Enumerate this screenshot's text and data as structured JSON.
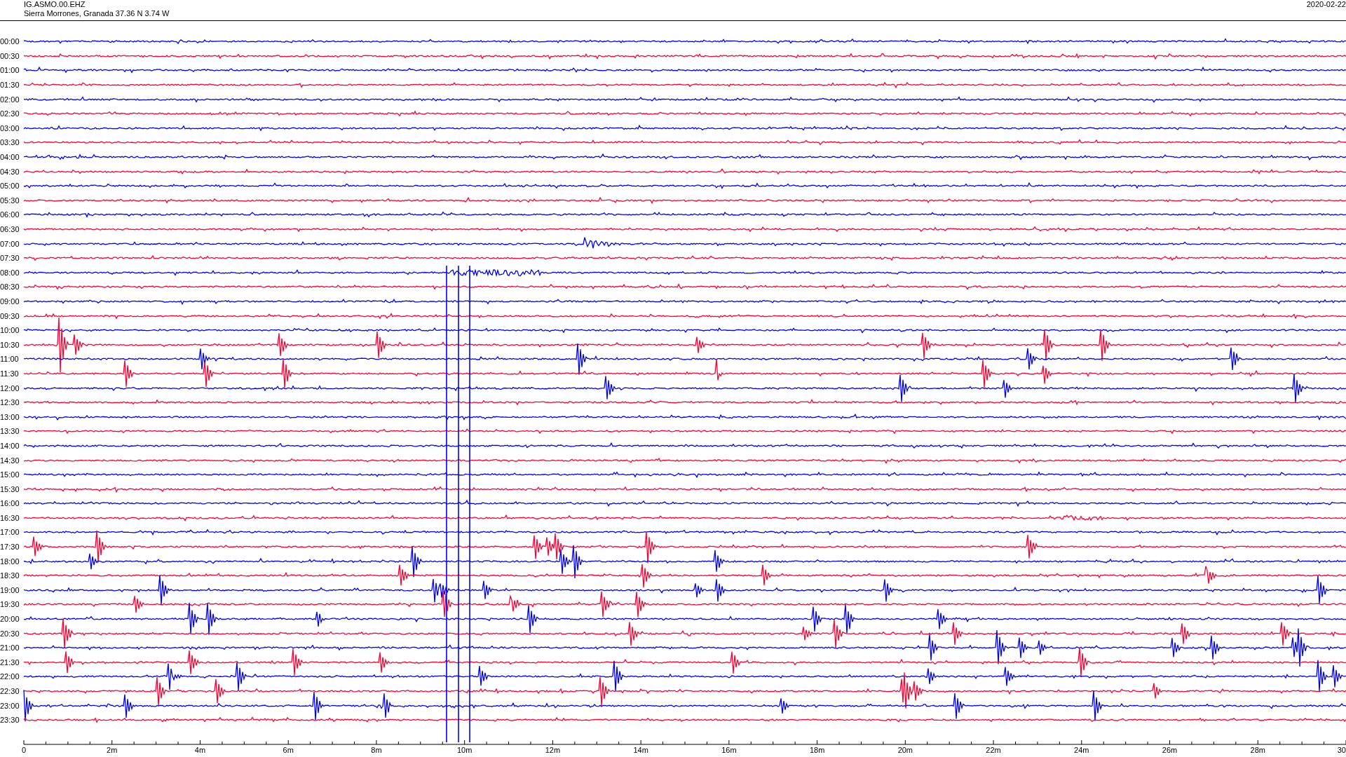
{
  "header": {
    "station": "IG.ASMO.00.EHZ",
    "location": "Sierra Morrones, Granada  37.36 N 3.74 W",
    "date": "2020-02-22"
  },
  "rows": [
    {
      "label": "00:00",
      "color": "#0000ff"
    },
    {
      "label": "00:30",
      "color": "#ff0033"
    },
    {
      "label": "01:00",
      "color": "#0000ff"
    },
    {
      "label": "01:30",
      "color": "#ff0033"
    },
    {
      "label": "02:00",
      "color": "#0000ff"
    },
    {
      "label": "02:30",
      "color": "#ff0033"
    },
    {
      "label": "03:00",
      "color": "#0000ff"
    },
    {
      "label": "03:30",
      "color": "#ff0033"
    },
    {
      "label": "04:00",
      "color": "#0000ff"
    },
    {
      "label": "04:30",
      "color": "#ff0033"
    },
    {
      "label": "05:00",
      "color": "#0000ff"
    },
    {
      "label": "05:30",
      "color": "#ff0033"
    },
    {
      "label": "06:00",
      "color": "#0000ff"
    },
    {
      "label": "06:30",
      "color": "#ff0033"
    },
    {
      "label": "07:00",
      "color": "#0000ff"
    },
    {
      "label": "07:30",
      "color": "#ff0033"
    },
    {
      "label": "08:00",
      "color": "#0000ff"
    },
    {
      "label": "08:30",
      "color": "#ff0033"
    },
    {
      "label": "09:00",
      "color": "#0000ff"
    },
    {
      "label": "09:30",
      "color": "#ff0033"
    },
    {
      "label": "10:00",
      "color": "#0000ff"
    },
    {
      "label": "10:30",
      "color": "#ff0033"
    },
    {
      "label": "11:00",
      "color": "#0000ff"
    },
    {
      "label": "11:30",
      "color": "#ff0033"
    },
    {
      "label": "12:00",
      "color": "#0000ff"
    },
    {
      "label": "12:30",
      "color": "#ff0033"
    },
    {
      "label": "13:00",
      "color": "#0000ff"
    },
    {
      "label": "13:30",
      "color": "#ff0033"
    },
    {
      "label": "14:00",
      "color": "#0000ff"
    },
    {
      "label": "14:30",
      "color": "#ff0033"
    },
    {
      "label": "15:00",
      "color": "#0000ff"
    },
    {
      "label": "15:30",
      "color": "#ff0033"
    },
    {
      "label": "16:00",
      "color": "#0000ff"
    },
    {
      "label": "16:30",
      "color": "#ff0033"
    },
    {
      "label": "17:00",
      "color": "#0000ff"
    },
    {
      "label": "17:30",
      "color": "#ff0033"
    },
    {
      "label": "18:00",
      "color": "#0000ff"
    },
    {
      "label": "18:30",
      "color": "#ff0033"
    },
    {
      "label": "19:00",
      "color": "#0000ff"
    },
    {
      "label": "19:30",
      "color": "#ff0033"
    },
    {
      "label": "20:00",
      "color": "#0000ff"
    },
    {
      "label": "20:30",
      "color": "#ff0033"
    },
    {
      "label": "21:00",
      "color": "#0000ff"
    },
    {
      "label": "21:30",
      "color": "#ff0033"
    },
    {
      "label": "22:00",
      "color": "#0000ff"
    },
    {
      "label": "22:30",
      "color": "#ff0033"
    },
    {
      "label": "23:00",
      "color": "#0000ff"
    },
    {
      "label": "23:30",
      "color": "#ff0033"
    }
  ],
  "x_axis": {
    "ticks": [
      "0",
      "2m",
      "4m",
      "6m",
      "8m",
      "10m",
      "12m",
      "14m",
      "16m",
      "18m",
      "20m",
      "22m",
      "24m",
      "26m",
      "28m",
      "30"
    ]
  }
}
